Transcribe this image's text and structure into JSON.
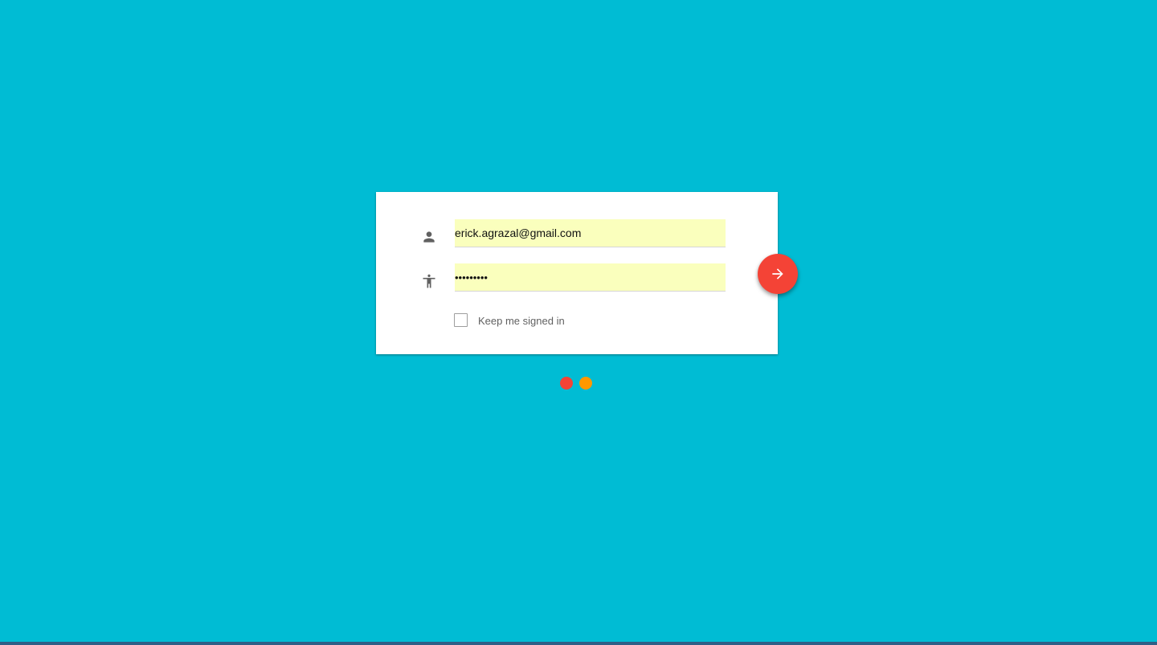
{
  "login": {
    "email_value": "erick.agrazal@gmail.com",
    "password_value": "•••••••••",
    "keep_signed_in_label": "Keep me signed in",
    "keep_signed_in_checked": false
  },
  "icons": {
    "email": "person-icon",
    "password": "accessibility-icon",
    "submit": "arrow-forward-icon"
  },
  "colors": {
    "background": "#00BCD4",
    "card": "#FFFFFF",
    "autofill_field": "#FAFFBD",
    "fab": "#F44336",
    "icon": "#616161",
    "dot_1": "#F44336",
    "dot_2": "#FF9800"
  },
  "loading_dots": [
    {
      "color": "#F44336"
    },
    {
      "color": "#FF9800"
    }
  ]
}
